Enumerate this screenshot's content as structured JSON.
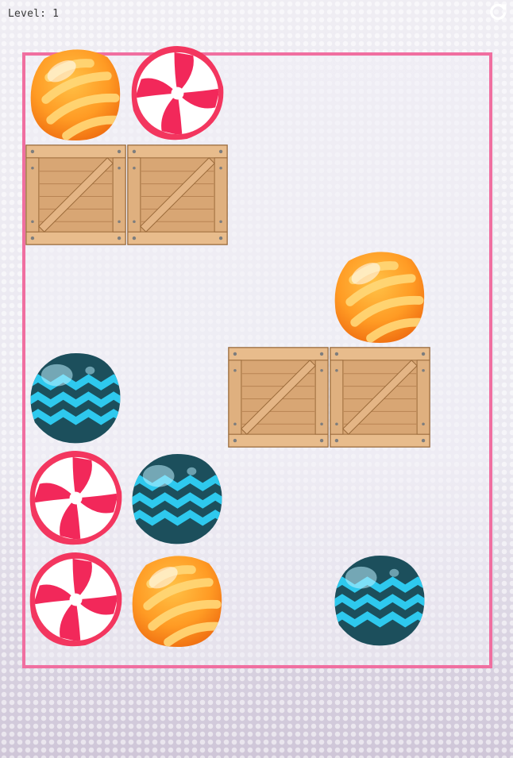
{
  "hud": {
    "level_label": "Level: 1",
    "restart_icon": "restart-icon"
  },
  "board": {
    "columns": 4,
    "rows": 6,
    "tiles": [
      {
        "row": 0,
        "col": 0,
        "type": "orange-candy"
      },
      {
        "row": 0,
        "col": 1,
        "type": "red-candy"
      },
      {
        "row": 1,
        "col": 0,
        "type": "crate"
      },
      {
        "row": 1,
        "col": 1,
        "type": "crate"
      },
      {
        "row": 2,
        "col": 3,
        "type": "orange-candy"
      },
      {
        "row": 3,
        "col": 0,
        "type": "blue-candy"
      },
      {
        "row": 3,
        "col": 2,
        "type": "crate"
      },
      {
        "row": 3,
        "col": 3,
        "type": "crate"
      },
      {
        "row": 4,
        "col": 0,
        "type": "red-candy"
      },
      {
        "row": 4,
        "col": 1,
        "type": "blue-candy"
      },
      {
        "row": 5,
        "col": 0,
        "type": "red-candy"
      },
      {
        "row": 5,
        "col": 1,
        "type": "orange-candy"
      },
      {
        "row": 5,
        "col": 3,
        "type": "blue-candy"
      }
    ]
  },
  "colors": {
    "board_border": "#f06fa0",
    "orange_candy": "#ff8a1e",
    "red_candy": "#f2285a",
    "blue_candy": "#1fb9e0",
    "crate": "#c9955e"
  }
}
